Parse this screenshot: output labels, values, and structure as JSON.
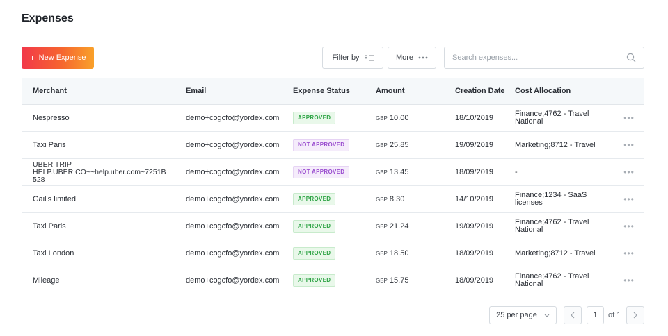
{
  "page": {
    "title": "Expenses"
  },
  "toolbar": {
    "new_expense_label": "New Expense",
    "new_expense_icon": "plus-icon",
    "filter_label": "Filter by",
    "filter_icon": "filter-lines-icon",
    "more_label": "More",
    "more_icon": "ellipsis-icon",
    "search_placeholder": "Search expenses...",
    "search_icon": "search-icon"
  },
  "table": {
    "columns": {
      "merchant": "Merchant",
      "email": "Email",
      "status": "Expense Status",
      "amount": "Amount",
      "date": "Creation Date",
      "cost": "Cost Allocation"
    },
    "rows": [
      {
        "merchant": "Nespresso",
        "email": "demo+cogcfo@yordex.com",
        "status": "APPROVED",
        "currency": "GBP",
        "amount": "10.00",
        "date": "18/10/2019",
        "cost": "Finance;4762 - Travel National",
        "actions": "•••"
      },
      {
        "merchant": "Taxi Paris",
        "email": "demo+cogcfo@yordex.com",
        "status": "NOT APPROVED",
        "currency": "GBP",
        "amount": "25.85",
        "date": "19/09/2019",
        "cost": "Marketing;8712 - Travel",
        "actions": "•••"
      },
      {
        "merchant": "UBER TRIP HELP.UBER.CO~~help.uber.com~7251B 528",
        "email": "demo+cogcfo@yordex.com",
        "status": "NOT APPROVED",
        "currency": "GBP",
        "amount": "13.45",
        "date": "18/09/2019",
        "cost": "-",
        "actions": "•••"
      },
      {
        "merchant": "Gail's limited",
        "email": "demo+cogcfo@yordex.com",
        "status": "APPROVED",
        "currency": "GBP",
        "amount": "8.30",
        "date": "14/10/2019",
        "cost": "Finance;1234 - SaaS licenses",
        "actions": "•••"
      },
      {
        "merchant": "Taxi Paris",
        "email": "demo+cogcfo@yordex.com",
        "status": "APPROVED",
        "currency": "GBP",
        "amount": "21.24",
        "date": "19/09/2019",
        "cost": "Finance;4762 - Travel National",
        "actions": "•••"
      },
      {
        "merchant": "Taxi London",
        "email": "demo+cogcfo@yordex.com",
        "status": "APPROVED",
        "currency": "GBP",
        "amount": "18.50",
        "date": "18/09/2019",
        "cost": "Marketing;8712 - Travel",
        "actions": "•••"
      },
      {
        "merchant": "Mileage",
        "email": "demo+cogcfo@yordex.com",
        "status": "APPROVED",
        "currency": "GBP",
        "amount": "15.75",
        "date": "18/09/2019",
        "cost": "Finance;4762 - Travel National",
        "actions": "•••"
      }
    ]
  },
  "pagination": {
    "per_page": "25 per page",
    "current_page": "1",
    "of_total": "of 1",
    "prev_icon": "chevron-left-icon",
    "next_icon": "chevron-right-icon",
    "dropdown_icon": "chevron-down-icon"
  },
  "colors": {
    "approved": "#2fa446",
    "not_approved": "#9b4fd0",
    "brand_gradient_start": "#f2384a",
    "brand_gradient_end": "#f9a12a"
  }
}
